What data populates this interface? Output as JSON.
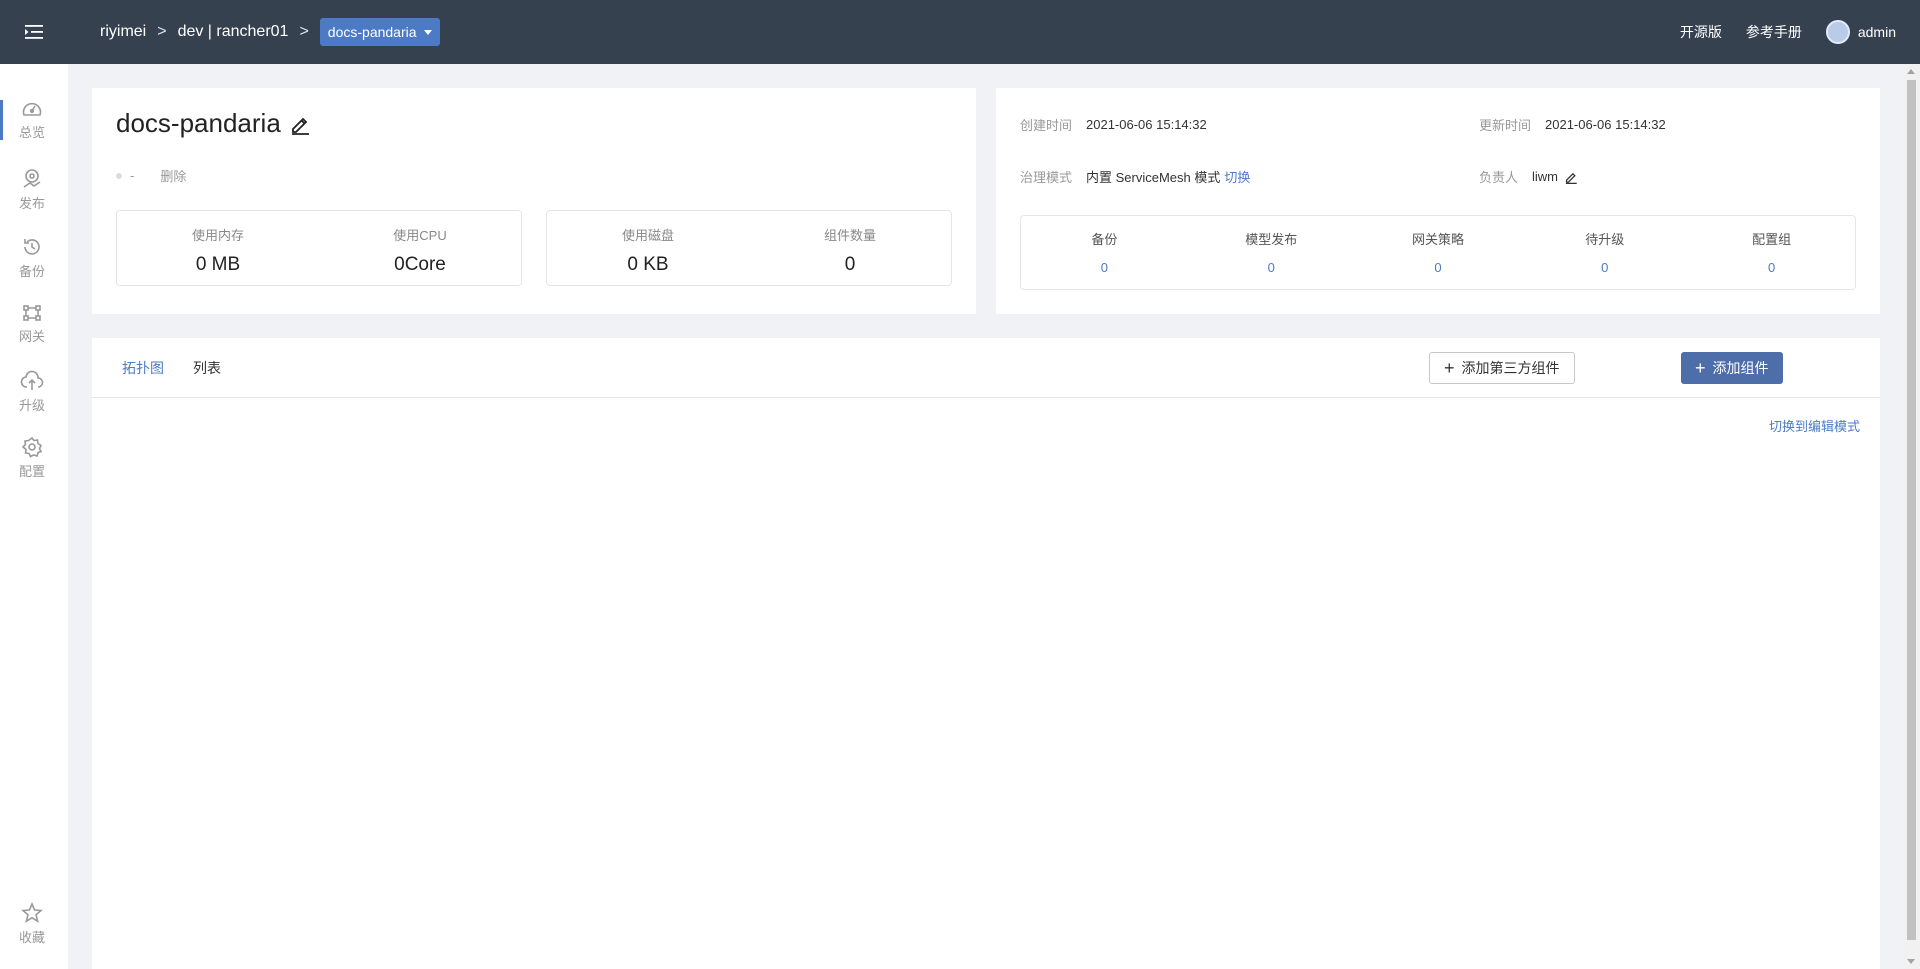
{
  "header": {
    "breadcrumb": [
      "riyimei",
      "dev | rancher01"
    ],
    "separator": ">",
    "current_app": "docs-pandaria",
    "links": [
      "开源版",
      "参考手册"
    ],
    "user": "admin"
  },
  "sidebar": {
    "items": [
      {
        "label": "总览",
        "icon": "dashboard-icon"
      },
      {
        "label": "发布",
        "icon": "publish-icon"
      },
      {
        "label": "备份",
        "icon": "backup-icon"
      },
      {
        "label": "网关",
        "icon": "gateway-icon"
      },
      {
        "label": "升级",
        "icon": "upgrade-icon"
      },
      {
        "label": "配置",
        "icon": "settings-icon"
      }
    ],
    "bottom_item": {
      "label": "收藏",
      "icon": "star-icon"
    }
  },
  "app_card": {
    "title": "docs-pandaria",
    "status": "-",
    "delete_label": "删除",
    "stats": [
      {
        "label": "使用内存",
        "value": "0 MB"
      },
      {
        "label": "使用CPU",
        "value": "0Core"
      },
      {
        "label": "使用磁盘",
        "value": "0 KB"
      },
      {
        "label": "组件数量",
        "value": "0"
      }
    ]
  },
  "info_card": {
    "created_label": "创建时间",
    "created_value": "2021-06-06 15:14:32",
    "updated_label": "更新时间",
    "updated_value": "2021-06-06 15:14:32",
    "mode_label": "治理模式",
    "mode_value": "内置 ServiceMesh 模式",
    "mode_switch": "切换",
    "owner_label": "负责人",
    "owner_value": "liwm",
    "counts": [
      {
        "label": "备份",
        "value": "0"
      },
      {
        "label": "模型发布",
        "value": "0"
      },
      {
        "label": "网关策略",
        "value": "0"
      },
      {
        "label": "待升级",
        "value": "0"
      },
      {
        "label": "配置组",
        "value": "0"
      }
    ]
  },
  "main": {
    "tabs": [
      "拓扑图",
      "列表"
    ],
    "add_third_party_label": "添加第三方组件",
    "add_component_label": "添加组件",
    "switch_edit_mode_label": "切换到编辑模式"
  },
  "colors": {
    "header_bg": "#364150",
    "accent": "#4d7ac5",
    "primary_button": "#4d6ea9"
  }
}
